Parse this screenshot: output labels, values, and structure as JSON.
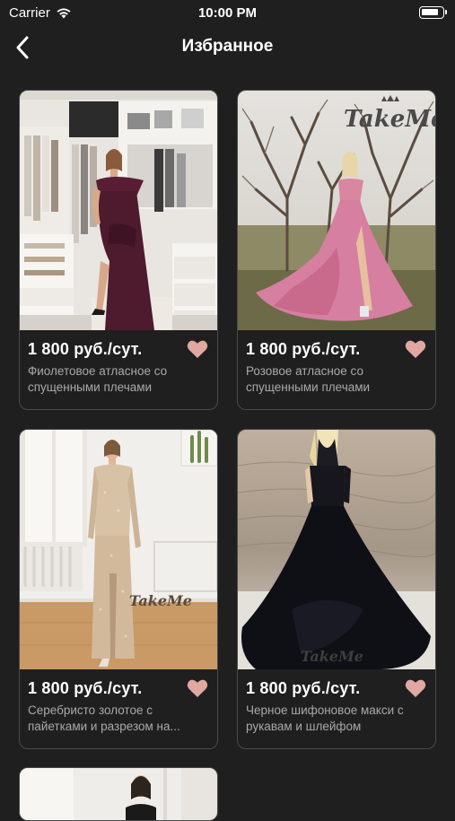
{
  "status": {
    "carrier": "Carrier",
    "time": "10:00 PM"
  },
  "nav": {
    "title": "Избранное"
  },
  "brand": {
    "logo": "TakeMe"
  },
  "colors": {
    "background": "#1f1f1f",
    "heart": "#e0a8a0",
    "card_border": "#4a4a4a",
    "muted_text": "#a9a9a9"
  },
  "cards": [
    {
      "price": "1 800 руб./сут.",
      "description": "Фиолетовое атласное со спущенными плечами"
    },
    {
      "price": "1 800 руб./сут.",
      "description": "Розовое атласное со спущенными плечами"
    },
    {
      "price": "1 800 руб./сут.",
      "description": "Серебристо золотое с пайетками и разрезом на..."
    },
    {
      "price": "1 800 руб./сут.",
      "description": "Черное шифоновое макси с рукавам и шлейфом"
    }
  ]
}
